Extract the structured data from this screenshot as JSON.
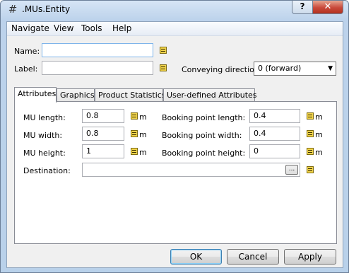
{
  "window": {
    "title": ".MUs.Entity",
    "help_label": "?",
    "close_label": "✕"
  },
  "menu": [
    "Navigate",
    "View",
    "Tools",
    "Help"
  ],
  "form": {
    "name_label": "Name:",
    "name_value": "",
    "label_label": "Label:",
    "label_value": "",
    "conveying_label": "Conveying direction:",
    "conveying_value": "0 (forward)"
  },
  "tabs": [
    "Attributes",
    "Graphics",
    "Product Statistics",
    "User-defined Attributes"
  ],
  "attributes": {
    "mu_length_label": "MU length:",
    "mu_length_value": "0.8",
    "mu_width_label": "MU width:",
    "mu_width_value": "0.8",
    "mu_height_label": "MU height:",
    "mu_height_value": "1",
    "bp_length_label": "Booking point length:",
    "bp_length_value": "0.4",
    "bp_width_label": "Booking point width:",
    "bp_width_value": "0.4",
    "bp_height_label": "Booking point height:",
    "bp_height_value": "0",
    "destination_label": "Destination:",
    "destination_value": "",
    "unit": "m",
    "ellipsis": "..."
  },
  "buttons": {
    "ok": "OK",
    "cancel": "Cancel",
    "apply": "Apply"
  }
}
